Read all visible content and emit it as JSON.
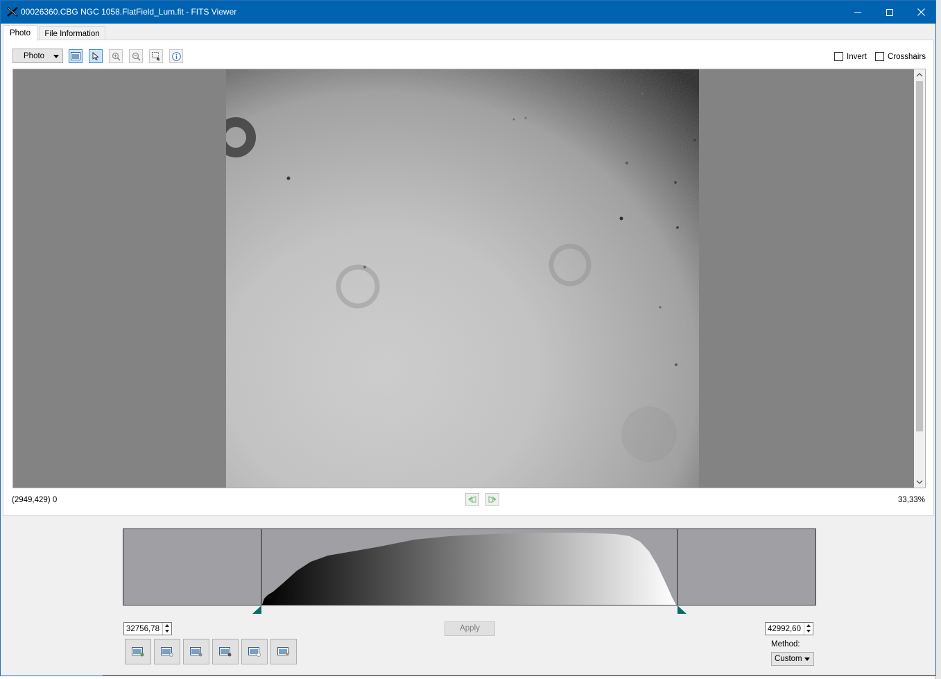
{
  "window": {
    "title": "00026360.CBG NGC 1058.FlatField_Lum.fit - FITS Viewer",
    "title_bar_color": "#0063b1"
  },
  "tabs": [
    {
      "label": "Photo",
      "active": true
    },
    {
      "label": "File Information",
      "active": false
    }
  ],
  "toolbar": {
    "view_mode": "Photo",
    "tools": [
      "fit-window-icon",
      "pointer-icon",
      "zoom-in-icon",
      "zoom-out-icon",
      "zoom-region-icon",
      "info-icon"
    ],
    "invert_label": "Invert",
    "invert_checked": false,
    "crosshairs_label": "Crosshairs",
    "crosshairs_checked": false
  },
  "status": {
    "coordinates": "(2949,429) 0",
    "zoom": "33,33%"
  },
  "histogram": {
    "min_value": "32756,78",
    "max_value": "42992,60",
    "apply_label": "Apply",
    "method_label": "Method:",
    "method_value": "Custom"
  }
}
